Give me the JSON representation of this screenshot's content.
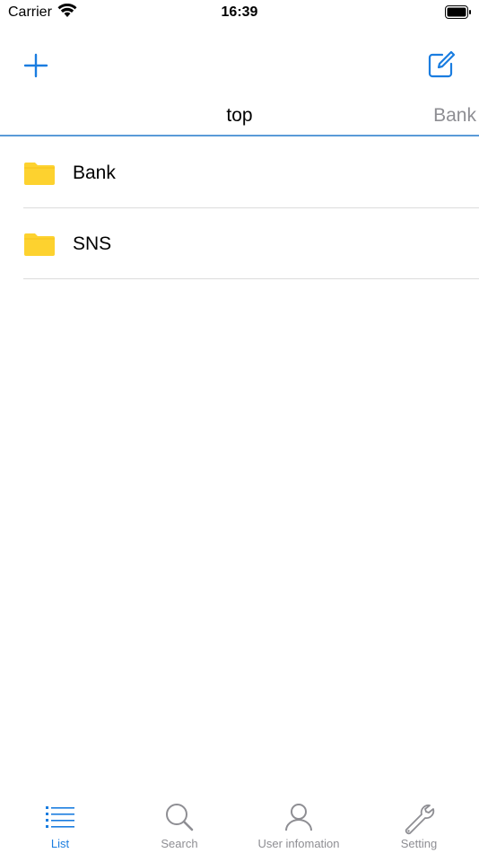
{
  "status_bar": {
    "carrier": "Carrier",
    "time": "16:39"
  },
  "breadcrumbs": {
    "current": "top",
    "next": "Bank"
  },
  "folders": [
    {
      "label": "Bank",
      "icon": "folder-icon"
    },
    {
      "label": "SNS",
      "icon": "folder-icon"
    }
  ],
  "tabs": [
    {
      "label": "List",
      "icon": "list-icon",
      "active": true
    },
    {
      "label": "Search",
      "icon": "search-icon"
    },
    {
      "label": "User infomation",
      "icon": "user-icon"
    },
    {
      "label": "Setting",
      "icon": "wrench-icon"
    }
  ],
  "colors": {
    "accent": "#1a7de0",
    "folder": "#fdd22f",
    "inactive": "#8e8e93"
  }
}
